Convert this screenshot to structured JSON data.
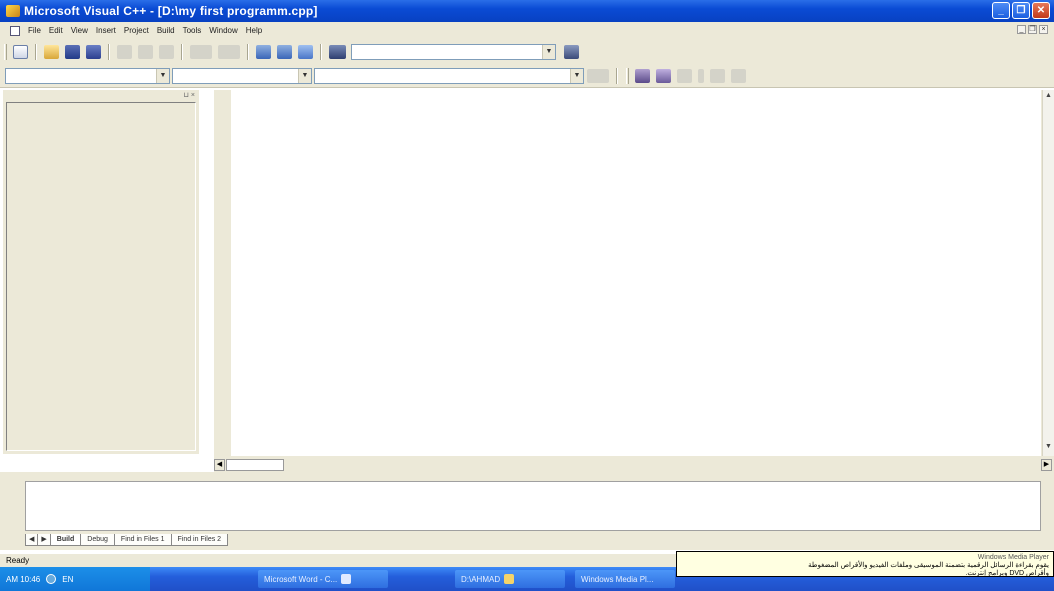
{
  "window": {
    "title": "Microsoft Visual C++ - [D:\\my first programm.cpp]",
    "buttons": [
      "_",
      "❐",
      "✕"
    ]
  },
  "menubar": {
    "items": [
      "File",
      "Edit",
      "View",
      "Insert",
      "Project",
      "Build",
      "Tools",
      "Window",
      "Help"
    ],
    "mdi_buttons": [
      "_",
      "❐",
      "×"
    ]
  },
  "toolbar": {
    "find_value": "",
    "class_combo": "",
    "members_combo": "",
    "functions_combo": ""
  },
  "output_tabs": [
    "Build",
    "Debug",
    "Find in Files 1",
    "Find in Files 2"
  ],
  "statusbar": {
    "text": "Ready"
  },
  "taskbar": {
    "clock": "AM 10:46",
    "lang": "EN",
    "tasks": [
      "Microsoft Word - C...",
      "D:\\AHMAD",
      "Windows Media Pl..."
    ]
  },
  "balloon": {
    "title": "Windows Media Player",
    "line1": "يقوم بقراءة الرسائل الرقمية بتضمنة الموسيقى وملفات الفيديو والأقراص المضغوطة",
    "line2": "وأقراص DVD وبرامج إنترنت."
  },
  "colors": {
    "titlebar": "#0a4bd4",
    "chrome": "#ece9d8",
    "taskbar": "#245edb",
    "balloon": "#ffffe1"
  }
}
